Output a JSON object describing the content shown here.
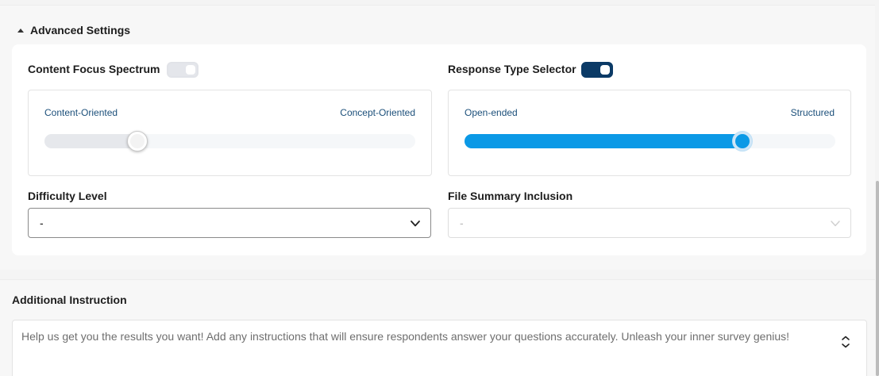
{
  "advanced_settings": {
    "title": "Advanced Settings",
    "expanded": true
  },
  "content_focus": {
    "label": "Content Focus Spectrum",
    "toggle_on": false,
    "min_label": "Content-Oriented",
    "max_label": "Concept-Oriented",
    "value_fraction": 0.25
  },
  "response_type": {
    "label": "Response Type Selector",
    "toggle_on": true,
    "min_label": "Open-ended",
    "max_label": "Structured",
    "value_fraction": 0.75
  },
  "difficulty": {
    "label": "Difficulty Level",
    "value": "-"
  },
  "file_summary": {
    "label": "File Summary Inclusion",
    "value": "-",
    "disabled": true
  },
  "additional_instruction": {
    "label": "Additional Instruction",
    "placeholder": "Help us get you the results you want! Add any instructions that will ensure respondents answer your questions accurately. Unleash your inner survey genius!"
  },
  "colors": {
    "accent_blue": "#0b99e6",
    "toggle_on": "#0b3a66",
    "slider_label": "#1b4f7a"
  },
  "icons": {
    "collapse": "caret-up-icon",
    "dropdown": "chevron-down-icon",
    "expand": "expand-vertical-icon"
  }
}
